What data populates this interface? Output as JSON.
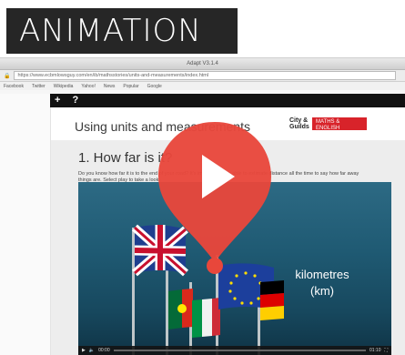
{
  "tag": {
    "label": "ANIMATION"
  },
  "browser": {
    "title": "Adapt V3.1.4",
    "url": "https://www.ecbmlowsguy.com/en/ib/mathsstories/units-and-measurements/index.html",
    "bookmarks": [
      "Facebook",
      "Twitter",
      "Wikipedia",
      "Yahoo!",
      "News",
      "Popular",
      "Google"
    ]
  },
  "course_nav": {
    "plus": "+",
    "help": "?"
  },
  "page": {
    "title": "Using units and measurements",
    "logo_line1": "City &",
    "logo_line2": "Guilds",
    "logo_badge": "MATHS & ENGLISH"
  },
  "section": {
    "heading": "1. How far is it?",
    "blurb": "Do you know how far it is to the end of your road? It's important to be able to estimate distance all the time to say how far away things are. Select play to take a look."
  },
  "video": {
    "label_line1": "kilometres",
    "label_line2": "(km)",
    "progress": 0.0,
    "time": "00:00",
    "time_total": "01:10"
  },
  "colors": {
    "accent": "#e8473b",
    "brand": "#d8232a"
  }
}
